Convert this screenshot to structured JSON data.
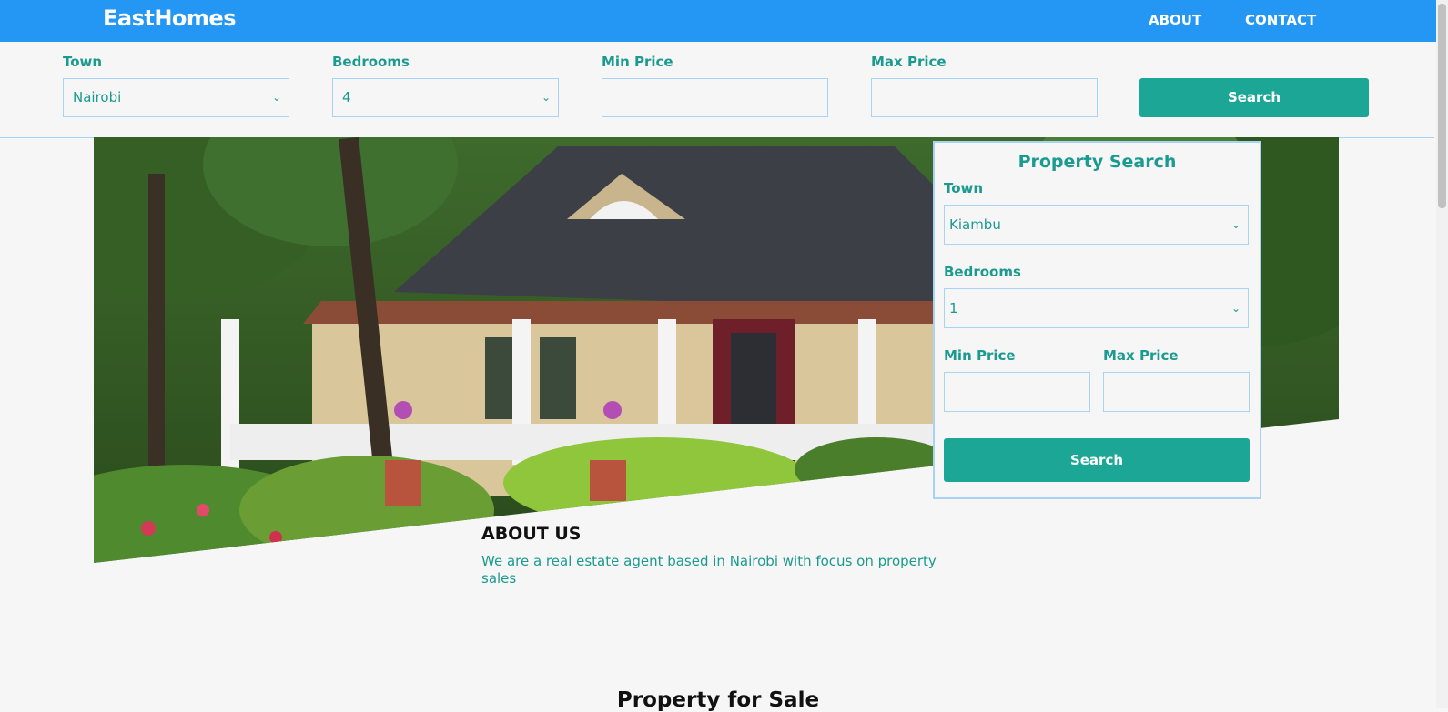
{
  "navbar": {
    "brand": "EastHomes",
    "links": [
      "ABOUT",
      "CONTACT"
    ],
    "color": "#2497f4"
  },
  "top_search": {
    "town_label": "Town",
    "town_value": "Nairobi",
    "bedrooms_label": "Bedrooms",
    "bedrooms_value": "4",
    "min_price_label": "Min Price",
    "min_price_value": "",
    "max_price_label": "Max Price",
    "max_price_value": "",
    "search_button": "Search"
  },
  "panel": {
    "title": "Property Search",
    "town_label": "Town",
    "town_value": "Kiambu",
    "bedrooms_label": "Bedrooms",
    "bedrooms_value": "1",
    "min_price_label": "Min Price",
    "min_price_value": "",
    "max_price_label": "Max Price",
    "max_price_value": "",
    "search_button": "Search"
  },
  "about": {
    "title": "ABOUT US",
    "text": "We are a real estate agent based in Nairobi with focus on property sales"
  },
  "sale_title": "Property for Sale",
  "icons": {
    "chevron": "chevron-down-icon"
  },
  "colors": {
    "accent": "#1ba696",
    "label": "#1b9a8f",
    "border": "#a9d3f3"
  }
}
